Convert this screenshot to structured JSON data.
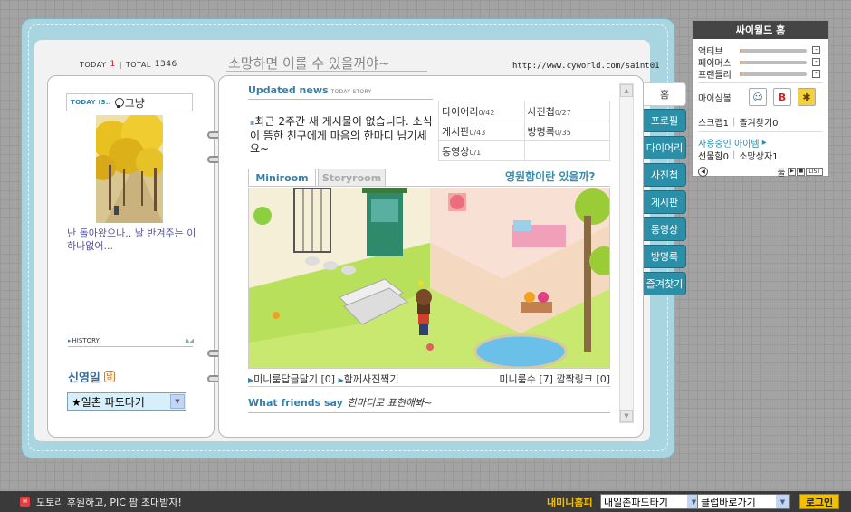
{
  "header": {
    "today_label": "TODAY",
    "today_count": "1",
    "total_label": "TOTAL",
    "total_count": "1346",
    "title": "소망하면 이룰 수 있을꺼야~",
    "url": "http://www.cyworld.com/saint01"
  },
  "left": {
    "today_is_label": "TODAY IS..",
    "mood": "그냥",
    "intro": "난 돌아왔으나.. 날 반겨주는 이 하나없어...",
    "history_label": "HISTORY",
    "name": "신영일",
    "gender_icon": "남",
    "select_value": "★일촌 파도타기"
  },
  "news": {
    "title": "Updated news",
    "subtitle": "TODAY STORY",
    "message": "최근 2주간 새 게시물이 없습니다. 소식이 뜸한 친구에게 마음의 한마디 남기세요~"
  },
  "stats": [
    [
      {
        "label": "다이어리",
        "count": "0/42"
      },
      {
        "label": "사진첩",
        "count": "0/27"
      }
    ],
    [
      {
        "label": "게시판",
        "count": "0/43"
      },
      {
        "label": "방명록",
        "count": "0/35"
      }
    ],
    [
      {
        "label": "동영상",
        "count": "0/1"
      },
      {
        "label": "",
        "count": ""
      }
    ]
  ],
  "miniroom": {
    "tab_miniroom": "Miniroom",
    "tab_storyroom": "Storyroom",
    "room_title": "영원함이란 있을까?",
    "link_reply": "미니룸답글달기 [0]",
    "link_photo": "함께사진찍기",
    "link_count": "미니룸수 [7]",
    "link_sparkle": "깜짝링크 [0]"
  },
  "friends": {
    "title": "What friends say",
    "message": "한마디로 표현해봐~"
  },
  "side_tabs": [
    "홈",
    "프로필",
    "다이어리",
    "사진첩",
    "게시판",
    "동영상",
    "방명록",
    "즐겨찾기"
  ],
  "cy_panel": {
    "title": "싸이월드 홈",
    "bars": [
      {
        "label": "액티브",
        "level": 0.02
      },
      {
        "label": "페이머스",
        "level": 0.02
      },
      {
        "label": "프랜들리",
        "level": 0.02
      }
    ],
    "my_label": "마이심볼",
    "scrap": "스크랩1",
    "favorites": "즐겨찾기0",
    "items_label": "사용중인 아이템",
    "gifts": "선물함0",
    "wishbox": "소망상자1",
    "dul": "둘",
    "list": "LIST"
  },
  "bottom": {
    "promo": "도토리 후원하고, PIC 팜 초대받자!",
    "my_minihompy": "내미니홈피",
    "select1": "내일촌파도타기",
    "select2": "클럽바로가기",
    "login": "로그인"
  },
  "colors": {
    "accent": "#3a7fa8",
    "tab": "#2c8fa8",
    "frame": "#a8d5e0",
    "gold": "#f2c000"
  }
}
